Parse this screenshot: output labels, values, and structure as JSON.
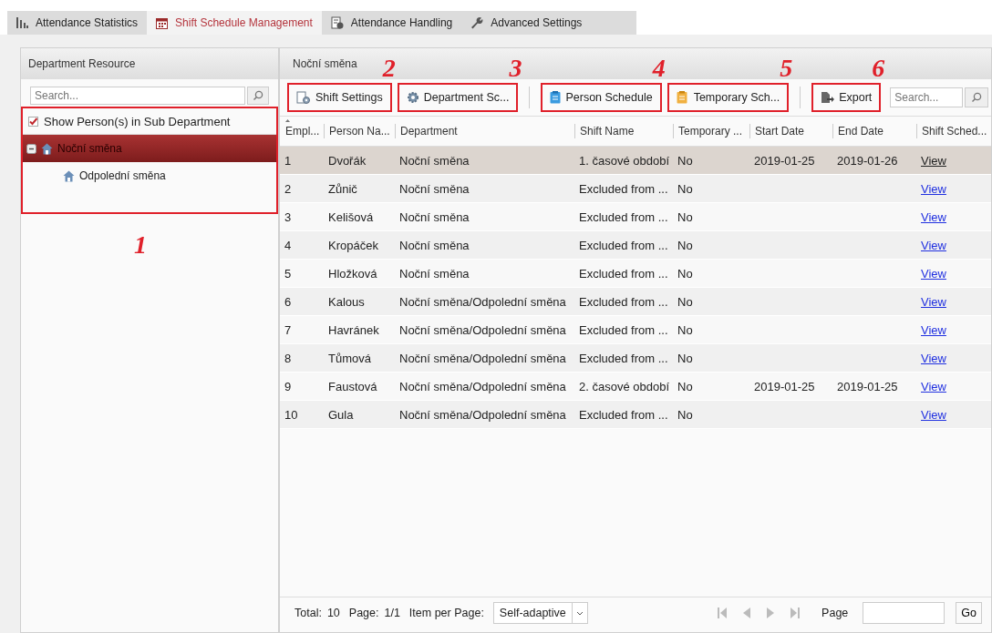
{
  "tabs": [
    {
      "label": "Attendance Statistics",
      "kind": "chart",
      "selected": false
    },
    {
      "label": "Shift Schedule Management",
      "kind": "calendar",
      "selected": true
    },
    {
      "label": "Attendance Handling",
      "kind": "clipboard",
      "selected": false
    },
    {
      "label": "Advanced Settings",
      "kind": "wrench",
      "selected": false
    }
  ],
  "department_panel": {
    "title": "Department Resource",
    "search": {
      "placeholder": "Search..."
    },
    "annotation": "1",
    "show_sub": {
      "label": "Show Person(s) in Sub Department",
      "checked": true
    },
    "tree": [
      {
        "label": "Noční směna",
        "selected": true,
        "expanded": true,
        "children": [
          {
            "label": "Odpolední směna",
            "selected": false
          }
        ]
      }
    ]
  },
  "schedule_panel": {
    "title": "Noční směna",
    "toolbar": [
      {
        "label": "Shift Settings",
        "kind": "gear-doc",
        "annotation": "2"
      },
      {
        "label": "Department Sc...",
        "kind": "gear",
        "annotation": "3"
      },
      {
        "label": "Person Schedule",
        "kind": "doc-blue",
        "annotation": "4"
      },
      {
        "label": "Temporary Sch...",
        "kind": "doc-orange",
        "annotation": "5"
      },
      {
        "label": "Export",
        "kind": "export",
        "annotation": "6"
      }
    ],
    "search": {
      "placeholder": "Search..."
    },
    "table": {
      "columns": [
        {
          "label": "Empl...",
          "sorted": true
        },
        {
          "label": "Person Na...",
          "sorted": false
        },
        {
          "label": "Department",
          "sorted": false
        },
        {
          "label": "Shift Name",
          "sorted": false
        },
        {
          "label": "Temporary ...",
          "sorted": false
        },
        {
          "label": "Start Date",
          "sorted": false
        },
        {
          "label": "End Date",
          "sorted": false
        },
        {
          "label": "Shift Sched...",
          "sorted": false
        }
      ],
      "rows": [
        {
          "selected": true,
          "cells": [
            "1",
            "Dvořák",
            "Noční směna",
            "1. časové období",
            "No",
            "2019-01-25",
            "2019-01-26",
            "View"
          ]
        },
        {
          "selected": false,
          "cells": [
            "2",
            "Zůnič",
            "Noční směna",
            "Excluded from ...",
            "No",
            "",
            "",
            "View"
          ]
        },
        {
          "selected": false,
          "cells": [
            "3",
            "Kelišová",
            "Noční směna",
            "Excluded from ...",
            "No",
            "",
            "",
            "View"
          ]
        },
        {
          "selected": false,
          "cells": [
            "4",
            "Kropáček",
            "Noční směna",
            "Excluded from ...",
            "No",
            "",
            "",
            "View"
          ]
        },
        {
          "selected": false,
          "cells": [
            "5",
            "Hložková",
            "Noční směna",
            "Excluded from ...",
            "No",
            "",
            "",
            "View"
          ]
        },
        {
          "selected": false,
          "cells": [
            "6",
            "Kalous",
            "Noční směna/Odpolední směna",
            "Excluded from ...",
            "No",
            "",
            "",
            "View"
          ]
        },
        {
          "selected": false,
          "cells": [
            "7",
            "Havránek",
            "Noční směna/Odpolední směna",
            "Excluded from ...",
            "No",
            "",
            "",
            "View"
          ]
        },
        {
          "selected": false,
          "cells": [
            "8",
            "Tůmová",
            "Noční směna/Odpolední směna",
            "Excluded from ...",
            "No",
            "",
            "",
            "View"
          ]
        },
        {
          "selected": false,
          "cells": [
            "9",
            "Faustová",
            "Noční směna/Odpolední směna",
            "2. časové období",
            "No",
            "2019-01-25",
            "2019-01-25",
            "View"
          ]
        },
        {
          "selected": false,
          "cells": [
            "10",
            "Gula",
            "Noční směna/Odpolední směna",
            "Excluded from ...",
            "No",
            "",
            "",
            "View"
          ]
        }
      ]
    },
    "footer": {
      "total_label": "Total:",
      "total": "10",
      "page_label": "Page:",
      "page": "1/1",
      "per_page_label": "Item per Page:",
      "per_page": "Self-adaptive",
      "goto_label": "Page",
      "go": "Go"
    }
  }
}
